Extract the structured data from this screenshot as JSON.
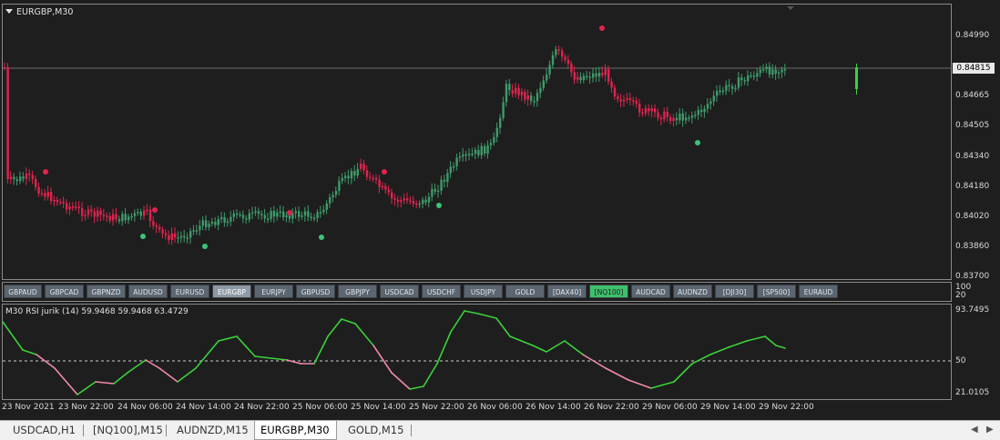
{
  "chart": {
    "title": "EURGBP,M30",
    "current_price": "0.84815",
    "price_axis": [
      "0.84990",
      "0.84815",
      "0.84665",
      "0.84505",
      "0.84340",
      "0.84180",
      "0.84020",
      "0.83860",
      "0.83700"
    ],
    "rsi_title": "M30  RSI jurik (14) 59.9468 59.9468 63.4729",
    "rsi_axis": [
      "100",
      "20",
      "93.7495",
      "50",
      "21.0105"
    ],
    "time_axis": [
      "23 Nov 2021",
      "23 Nov 22:00",
      "24 Nov 06:00",
      "24 Nov 14:00",
      "24 Nov 22:00",
      "25 Nov 06:00",
      "25 Nov 14:00",
      "25 Nov 22:00",
      "26 Nov 06:00",
      "26 Nov 14:00",
      "26 Nov 22:00",
      "29 Nov 06:00",
      "29 Nov 14:00",
      "29 Nov 22:00"
    ]
  },
  "symbols": [
    "GBPAUD",
    "GBPCAD",
    "GBPNZD",
    "AUDUSD",
    "EURUSD",
    "EURGBP",
    "EURJPY",
    "GBPUSD",
    "GBPJPY",
    "USDCAD",
    "USDCHF",
    "USDJPY",
    "GOLD",
    "[DAX40]",
    "[NQ100]",
    "AUDCAD",
    "AUDNZD",
    "[DJI30]",
    "[SP500]",
    "EURAUD"
  ],
  "active_symbol": "EURGBP",
  "highlighted_symbol": "[NQ100]",
  "tabs": [
    "USDCAD,H1",
    "[NQ100],M15",
    "AUDNZD,M15",
    "EURGBP,M30",
    "GOLD,M15"
  ],
  "active_tab": "EURGBP,M30",
  "colors": {
    "bull": "#3e9b6a",
    "bear": "#e0234e",
    "rsi_up": "#39d23a",
    "rsi_down": "#f28aa8",
    "dot_green": "#3cc47a",
    "dot_red": "#e0234e"
  },
  "icons": {
    "scroll_left": "scroll-left-icon",
    "scroll_right": "scroll-right-icon",
    "dropdown": "dropdown-triangle-icon"
  }
}
